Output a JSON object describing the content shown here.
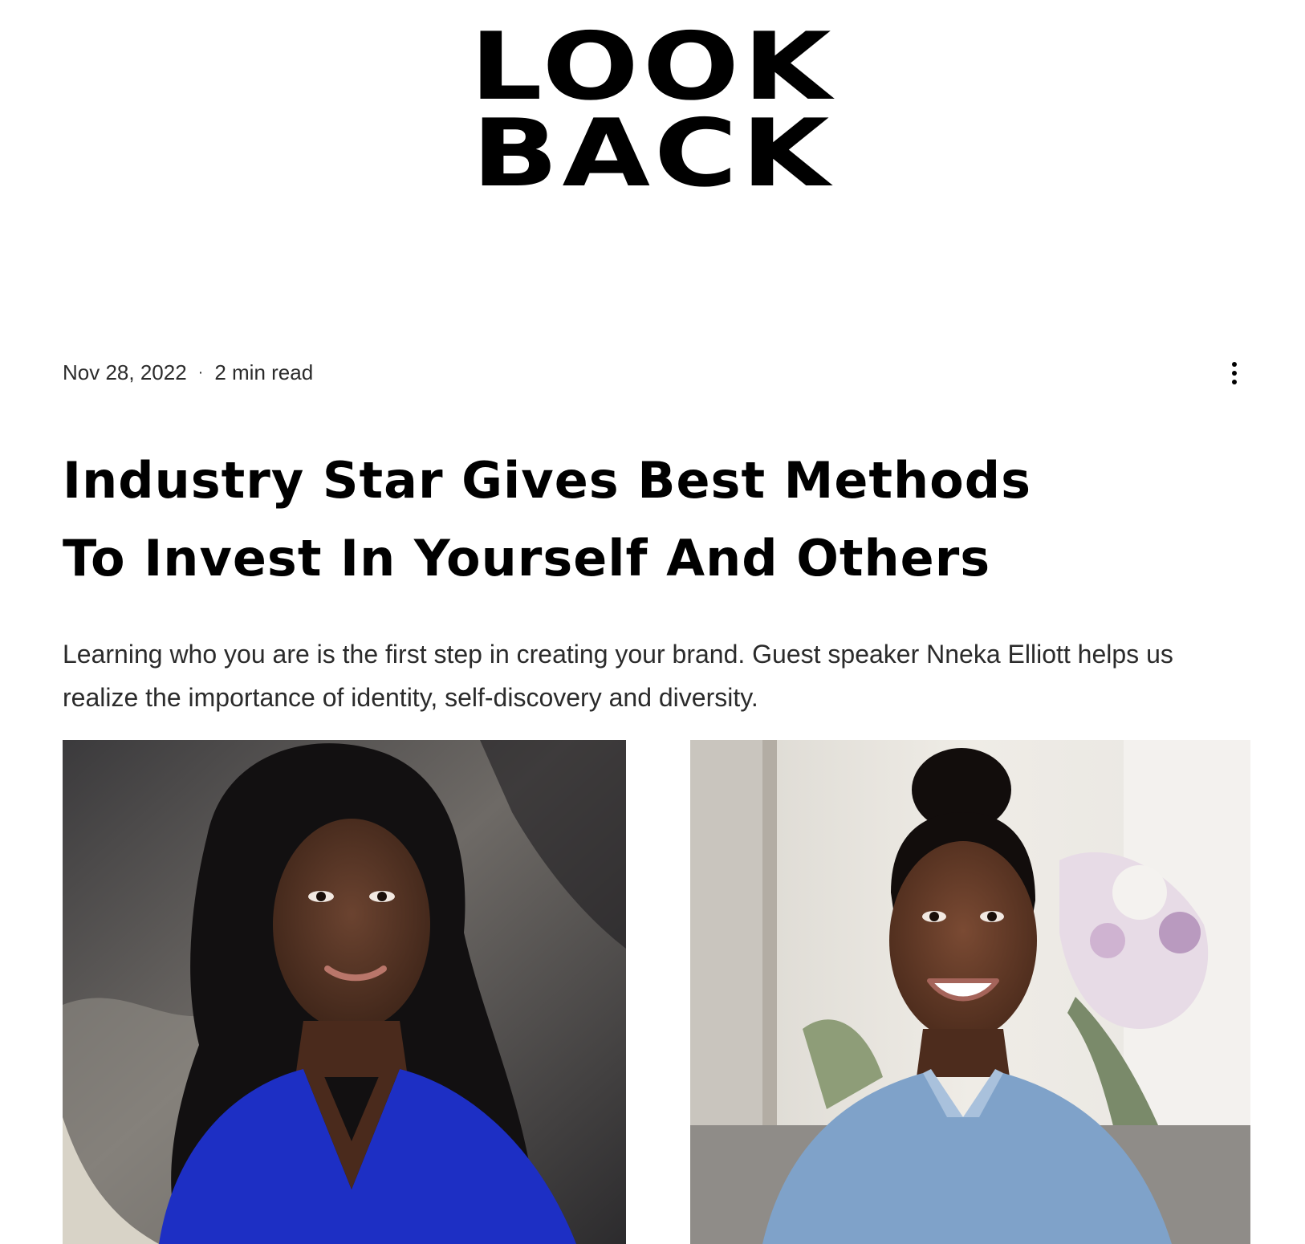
{
  "header": {
    "logo_line1": "LOOK",
    "logo_line2": "BACK"
  },
  "post": {
    "date": "Nov 28, 2022",
    "separator": "·",
    "read_time": "2 min read",
    "more_icon": "more-vertical-icon",
    "title_line1": "Industry Star Gives Best Methods",
    "title_line2": "To Invest In Yourself And Others",
    "excerpt": "Learning who you are is the first step in creating your brand. Guest speaker Nneka Elliott helps us realize the importance of identity, self-discovery and diversity."
  },
  "colors": {
    "text": "#000000",
    "secondary_text": "#2b2b2b",
    "background": "#ffffff"
  }
}
